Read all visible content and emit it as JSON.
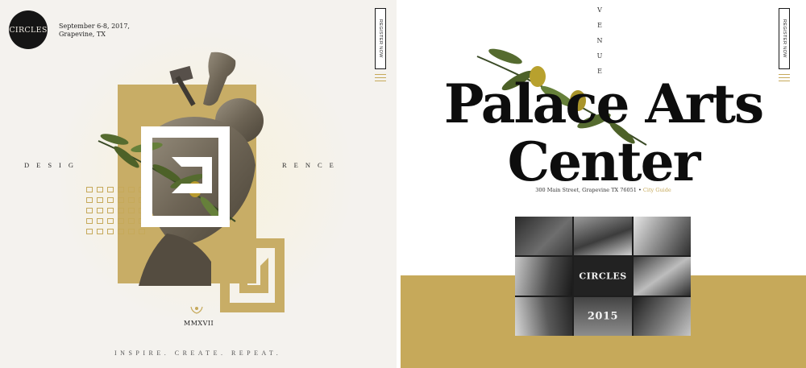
{
  "brand": {
    "logo_text": "CIRCLES"
  },
  "event": {
    "date": "September 6-8, 2017,",
    "location": "Grapevine, TX"
  },
  "register": {
    "label": "REGISTER NOW"
  },
  "left": {
    "keyword_left": "DESIG",
    "keyword_right": "RENCE",
    "year": "MMXVII",
    "tagline": "INSPIRE. CREATE. REPEAT."
  },
  "venue": {
    "section_label": "VENUE",
    "title_line1": "Palace Arts",
    "title_line2": "Center",
    "address": "300 Main Street, Grapevine TX 76051 •",
    "city_guide_link": "City Guide"
  },
  "collage": {
    "sign_text": "CIRCLES",
    "badge_text": "2015"
  },
  "colors": {
    "gold": "#c6a95a",
    "gold_light": "#c8ad66",
    "ink": "#0d0d0d",
    "paper": "#f4f2ee"
  },
  "icons": [
    "menu-icon",
    "laurel-icon",
    "olive-branch-icon",
    "statue-illustration"
  ]
}
